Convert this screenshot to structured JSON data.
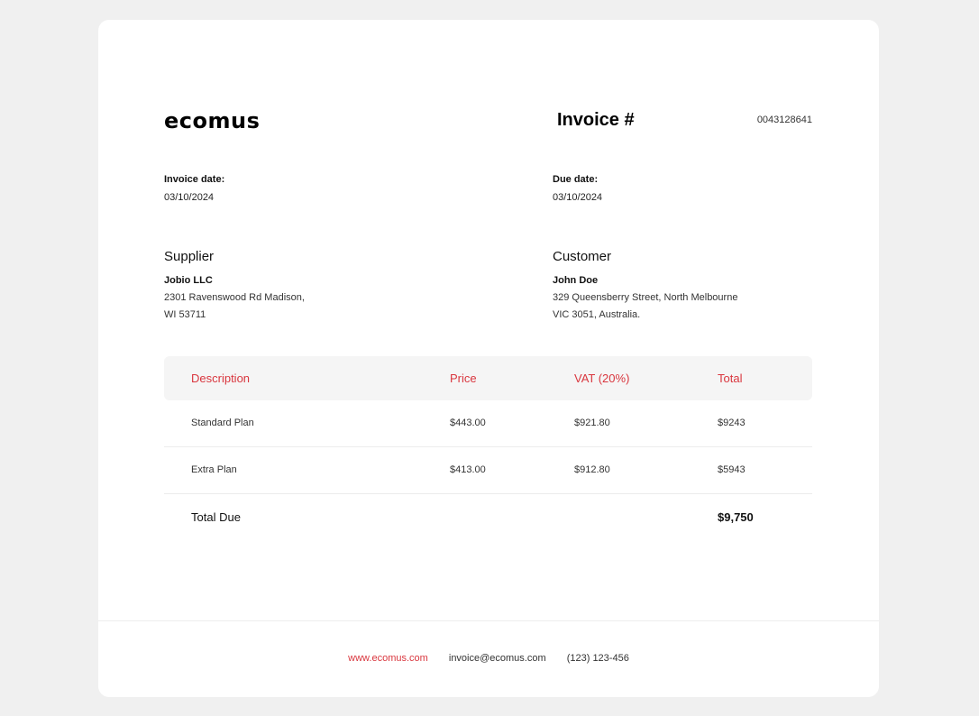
{
  "brand": {
    "logo_text": "ecomus"
  },
  "invoice": {
    "title": "Invoice #",
    "number": "0043128641",
    "date_label": "Invoice date:",
    "date_value": "03/10/2024",
    "due_label": "Due date:",
    "due_value": "03/10/2024"
  },
  "supplier": {
    "heading": "Supplier",
    "name": "Jobio LLC",
    "address_line1": "2301 Ravenswood Rd Madison,",
    "address_line2": "WI 53711"
  },
  "customer": {
    "heading": "Customer",
    "name": "John Doe",
    "address_line1": "329 Queensberry Street, North Melbourne",
    "address_line2": "VIC 3051, Australia."
  },
  "table": {
    "headers": [
      "Description",
      "Price",
      "VAT (20%)",
      "Total"
    ],
    "rows": [
      {
        "description": "Standard Plan",
        "price": "$443.00",
        "vat": "$921.80",
        "total": "$9243"
      },
      {
        "description": "Extra Plan",
        "price": "$413.00",
        "vat": "$912.80",
        "total": "$5943"
      }
    ],
    "total_due_label": "Total Due",
    "total_due_value": "$9,750"
  },
  "footer": {
    "website": "www.ecomus.com",
    "email": "invoice@ecomus.com",
    "phone": "(123) 123-456"
  },
  "colors": {
    "accent": "#d9363e",
    "page_background": "#f0f0f0",
    "header_row_background": "#f5f5f5"
  }
}
